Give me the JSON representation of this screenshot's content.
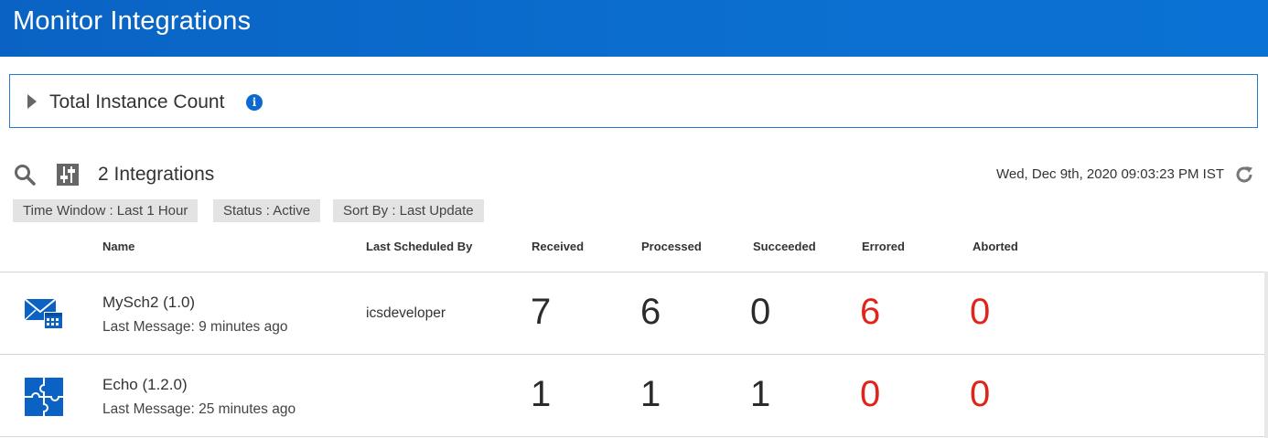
{
  "header": {
    "title": "Monitor Integrations"
  },
  "count_panel": {
    "label": "Total Instance Count"
  },
  "toolbar": {
    "count_label": "2 Integrations",
    "timestamp": "Wed, Dec 9th, 2020 09:03:23 PM IST"
  },
  "filters": [
    {
      "label": "Time Window : Last 1 Hour"
    },
    {
      "label": "Status : Active"
    },
    {
      "label": "Sort By : Last Update"
    }
  ],
  "columns": {
    "name": "Name",
    "last_scheduled_by": "Last Scheduled By",
    "received": "Received",
    "processed": "Processed",
    "succeeded": "Succeeded",
    "errored": "Errored",
    "aborted": "Aborted"
  },
  "integrations": [
    {
      "icon": "email-schedule-icon",
      "name": "MySch2 (1.0)",
      "last_message": "Last Message: 9 minutes ago",
      "last_scheduled_by": "icsdeveloper",
      "received": "7",
      "processed": "6",
      "succeeded": "0",
      "errored": "6",
      "aborted": "0"
    },
    {
      "icon": "puzzle-icon",
      "name": "Echo (1.2.0)",
      "last_message": "Last Message: 25 minutes ago",
      "last_scheduled_by": "",
      "received": "1",
      "processed": "1",
      "succeeded": "1",
      "errored": "0",
      "aborted": "0"
    }
  ],
  "colors": {
    "header_blue": "#0b6fd0",
    "error_red": "#e0241b",
    "chip_gray": "#e3e3e3"
  }
}
